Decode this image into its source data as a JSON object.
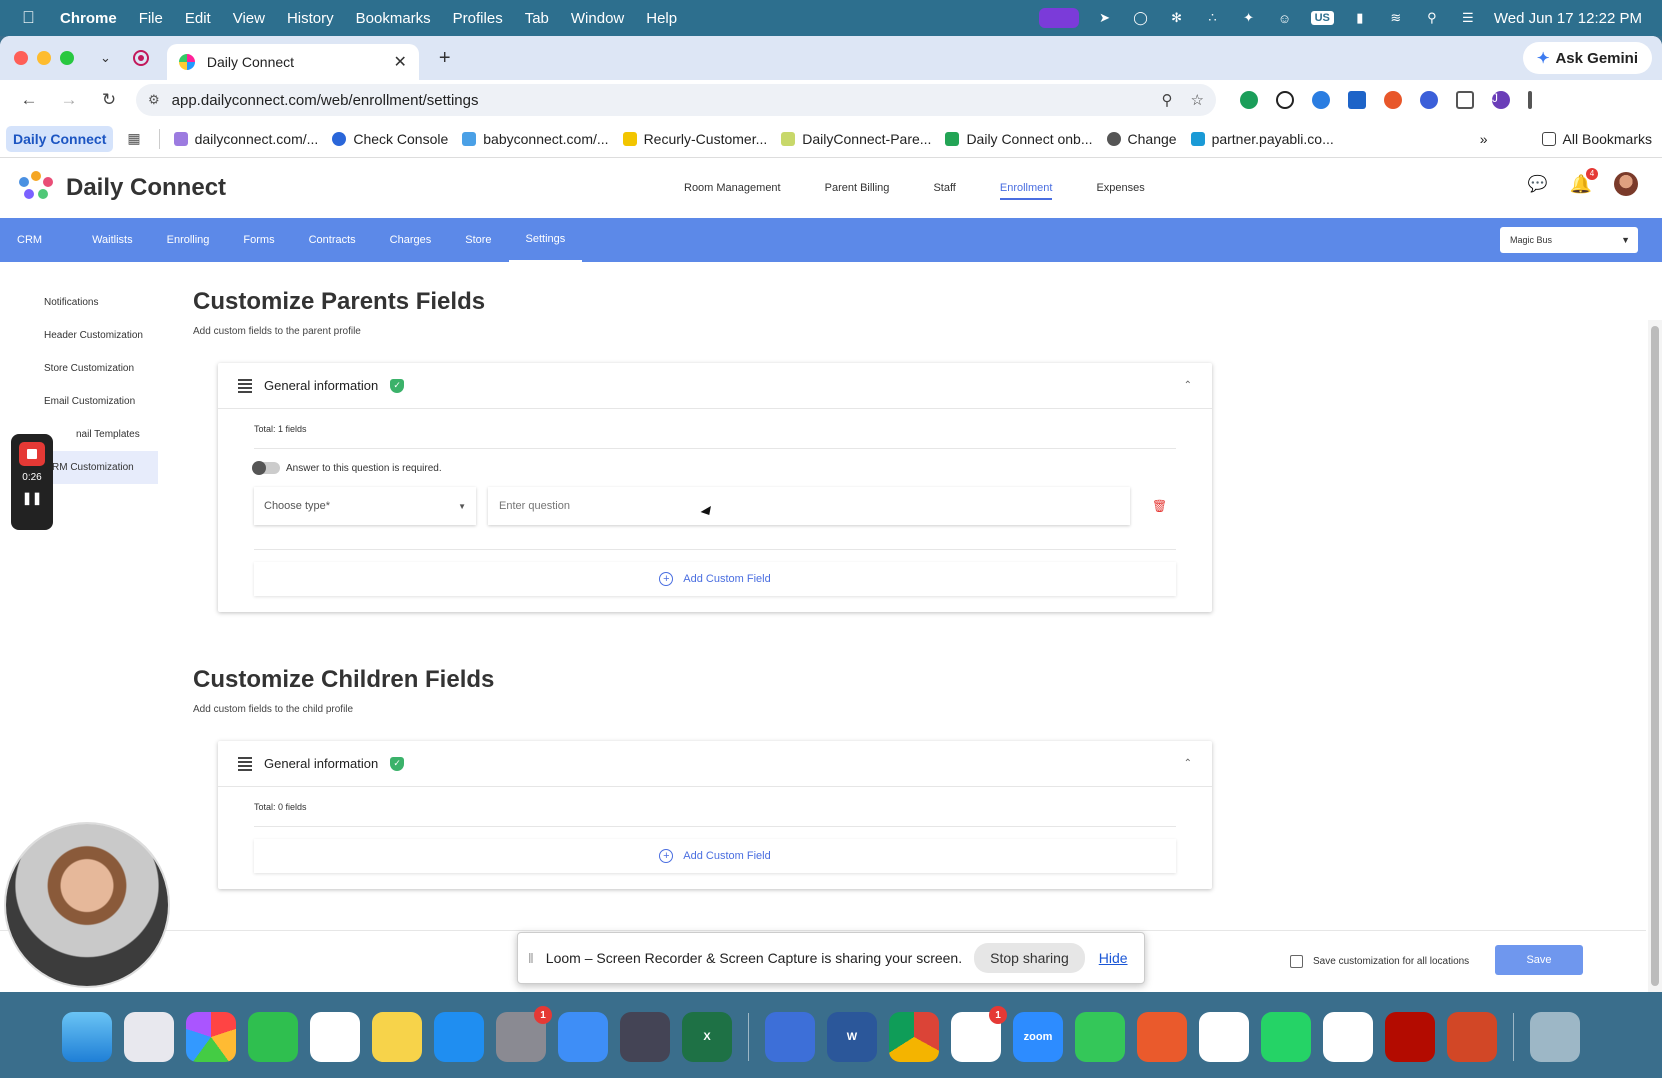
{
  "menubar": {
    "app_name": "Chrome",
    "items": [
      "File",
      "Edit",
      "View",
      "History",
      "Bookmarks",
      "Profiles",
      "Tab",
      "Window",
      "Help"
    ],
    "clock": "Wed Jun 17  12:22 PM",
    "keyboard": "US"
  },
  "browser": {
    "tab_title": "Daily Connect",
    "url": "app.dailyconnect.com/web/enrollment/settings",
    "ask_gemini": "Ask Gemini",
    "profile_initial": "J",
    "bookmarks": [
      "Daily Connect",
      "dailyconnect.com/...",
      "Check Console",
      "babyconnect.com/...",
      "Recurly-Customer...",
      "DailyConnect-Pare...",
      "Daily Connect onb...",
      "Change",
      "partner.payabli.co..."
    ],
    "all_bookmarks": "All Bookmarks"
  },
  "app": {
    "logo_text": "Daily Connect",
    "top_nav": [
      "Room Management",
      "Parent Billing",
      "Staff",
      "Enrollment",
      "Expenses"
    ],
    "top_nav_active": "Enrollment",
    "notification_count": "4",
    "sub_nav": [
      "CRM",
      "Waitlists",
      "Enrolling",
      "Forms",
      "Contracts",
      "Charges",
      "Store",
      "Settings"
    ],
    "sub_nav_active": "Settings",
    "location": "Magic Bus",
    "sidebar": [
      "Notifications",
      "Header Customization",
      "Store Customization",
      "Email Customization",
      "nail Templates",
      "RM Customization"
    ],
    "parents": {
      "title": "Customize Parents Fields",
      "subtitle": "Add custom fields to the parent profile",
      "group_title": "General information",
      "total": "Total: 1 fields",
      "required_label": "Answer to this question is required.",
      "type_placeholder": "Choose type*",
      "question_placeholder": "Enter question",
      "add_label": "Add Custom Field"
    },
    "children": {
      "title": "Customize Children Fields",
      "subtitle": "Add custom fields to the child profile",
      "group_title": "General information",
      "total": "Total: 0 fields",
      "add_label": "Add Custom Field"
    },
    "footer": {
      "save_all_label": "Save customization for all locations",
      "save_label": "Save"
    }
  },
  "recorder": {
    "time": "0:26"
  },
  "loom": {
    "message": "Loom – Screen Recorder & Screen Capture is sharing your screen.",
    "stop": "Stop sharing",
    "hide": "Hide"
  },
  "dock": {
    "apps": [
      "finder",
      "launchpad",
      "photos",
      "numbers",
      "reminders",
      "notes",
      "app-store",
      "system-settings",
      "files",
      "simulator",
      "excel",
      "pdf-tool",
      "word",
      "chrome",
      "slack",
      "zoom",
      "messages",
      "perplexity",
      "asana",
      "whatsapp",
      "chatgpt",
      "acrobat",
      "powerpoint",
      "trash"
    ],
    "settings_badge": "1",
    "slack_badge": "1",
    "zoom_label": "zoom"
  },
  "colors": {
    "accent": "#5c89e8",
    "link": "#4a6ee0",
    "success": "#3bb26a",
    "danger": "#e53935"
  }
}
